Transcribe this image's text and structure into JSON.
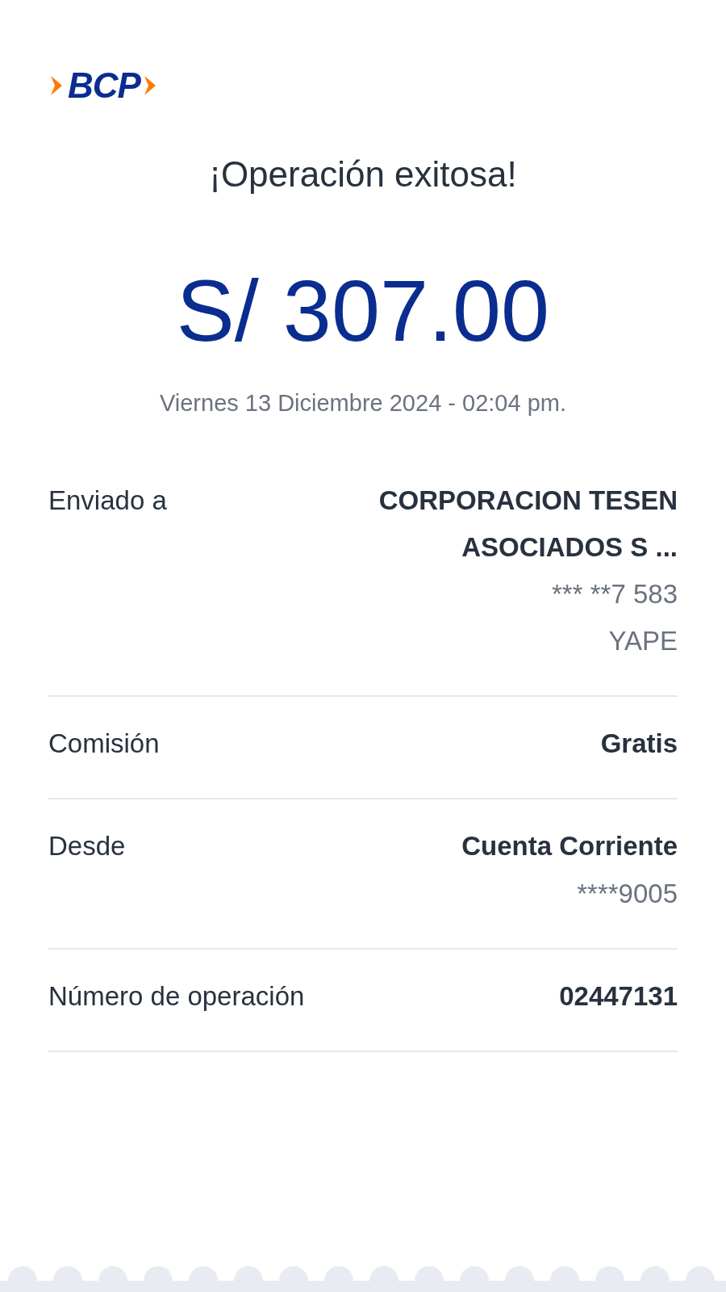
{
  "logo": {
    "text": "BCP"
  },
  "title": "¡Operación exitosa!",
  "amount": "S/ 307.00",
  "datetime": "Viernes 13 Diciembre 2024 - 02:04 pm.",
  "details": [
    {
      "label": "Enviado a",
      "values": [
        {
          "text": "CORPORACION TESEN",
          "kind": "primary"
        },
        {
          "text": "ASOCIADOS S ...",
          "kind": "primary"
        },
        {
          "text": "*** **7 583",
          "kind": "secondary"
        },
        {
          "text": "YAPE",
          "kind": "secondary"
        }
      ]
    },
    {
      "label": "Comisión",
      "values": [
        {
          "text": "Gratis",
          "kind": "primary"
        }
      ]
    },
    {
      "label": "Desde",
      "values": [
        {
          "text": "Cuenta Corriente",
          "kind": "primary"
        },
        {
          "text": "****9005",
          "kind": "secondary"
        }
      ]
    },
    {
      "label": "Número de operación",
      "values": [
        {
          "text": "02447131",
          "kind": "primary"
        }
      ]
    }
  ]
}
